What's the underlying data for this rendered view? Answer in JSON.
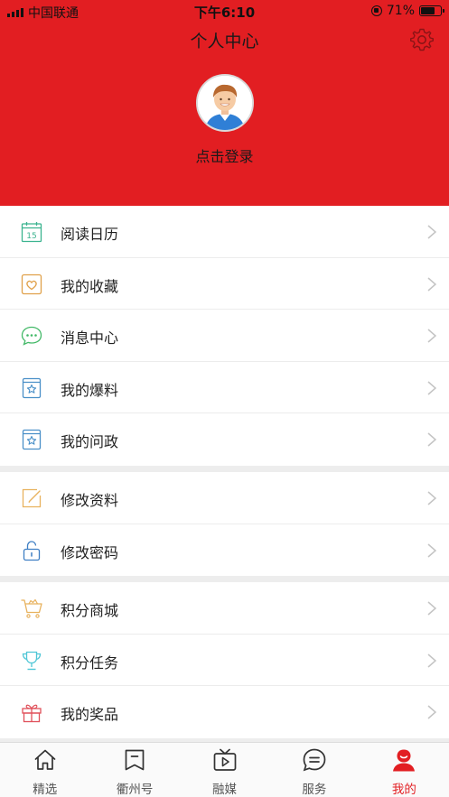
{
  "status_bar": {
    "carrier": "中国联通",
    "time": "下午6:10",
    "battery": "71%",
    "battery_level": 0.71
  },
  "header": {
    "title": "个人中心",
    "login_text": "点击登录",
    "background_color": "#e21e22"
  },
  "menu_groups": [
    {
      "items": [
        {
          "label": "阅读日历",
          "icon": "calendar-icon",
          "icon_text": "15",
          "color": "#3bb38f"
        },
        {
          "label": "我的收藏",
          "icon": "favorite-heart-icon",
          "color": "#e0a14a"
        },
        {
          "label": "消息中心",
          "icon": "message-bubble-icon",
          "color": "#43b968"
        },
        {
          "label": "我的爆料",
          "icon": "report-star-icon",
          "color": "#4a90c8"
        },
        {
          "label": "我的问政",
          "icon": "inquiry-star-icon",
          "color": "#4a90c8"
        }
      ]
    },
    {
      "items": [
        {
          "label": "修改资料",
          "icon": "edit-icon",
          "color": "#e8b25e"
        },
        {
          "label": "修改密码",
          "icon": "unlock-icon",
          "color": "#3f7fc4"
        }
      ]
    },
    {
      "items": [
        {
          "label": "积分商城",
          "icon": "shopping-cart-icon",
          "color": "#e8b25e"
        },
        {
          "label": "积分任务",
          "icon": "trophy-icon",
          "color": "#4ec6d6"
        },
        {
          "label": "我的奖品",
          "icon": "gift-icon",
          "color": "#e0505a"
        }
      ]
    }
  ],
  "tab_bar": {
    "tabs": [
      {
        "label": "精选",
        "icon": "home-icon",
        "active": false
      },
      {
        "label": "衢州号",
        "icon": "bookmark-icon",
        "active": false
      },
      {
        "label": "融媒",
        "icon": "tv-play-icon",
        "active": false
      },
      {
        "label": "服务",
        "icon": "service-chat-icon",
        "active": false
      },
      {
        "label": "我的",
        "icon": "profile-icon",
        "active": true
      }
    ],
    "active_color": "#e21e22"
  }
}
